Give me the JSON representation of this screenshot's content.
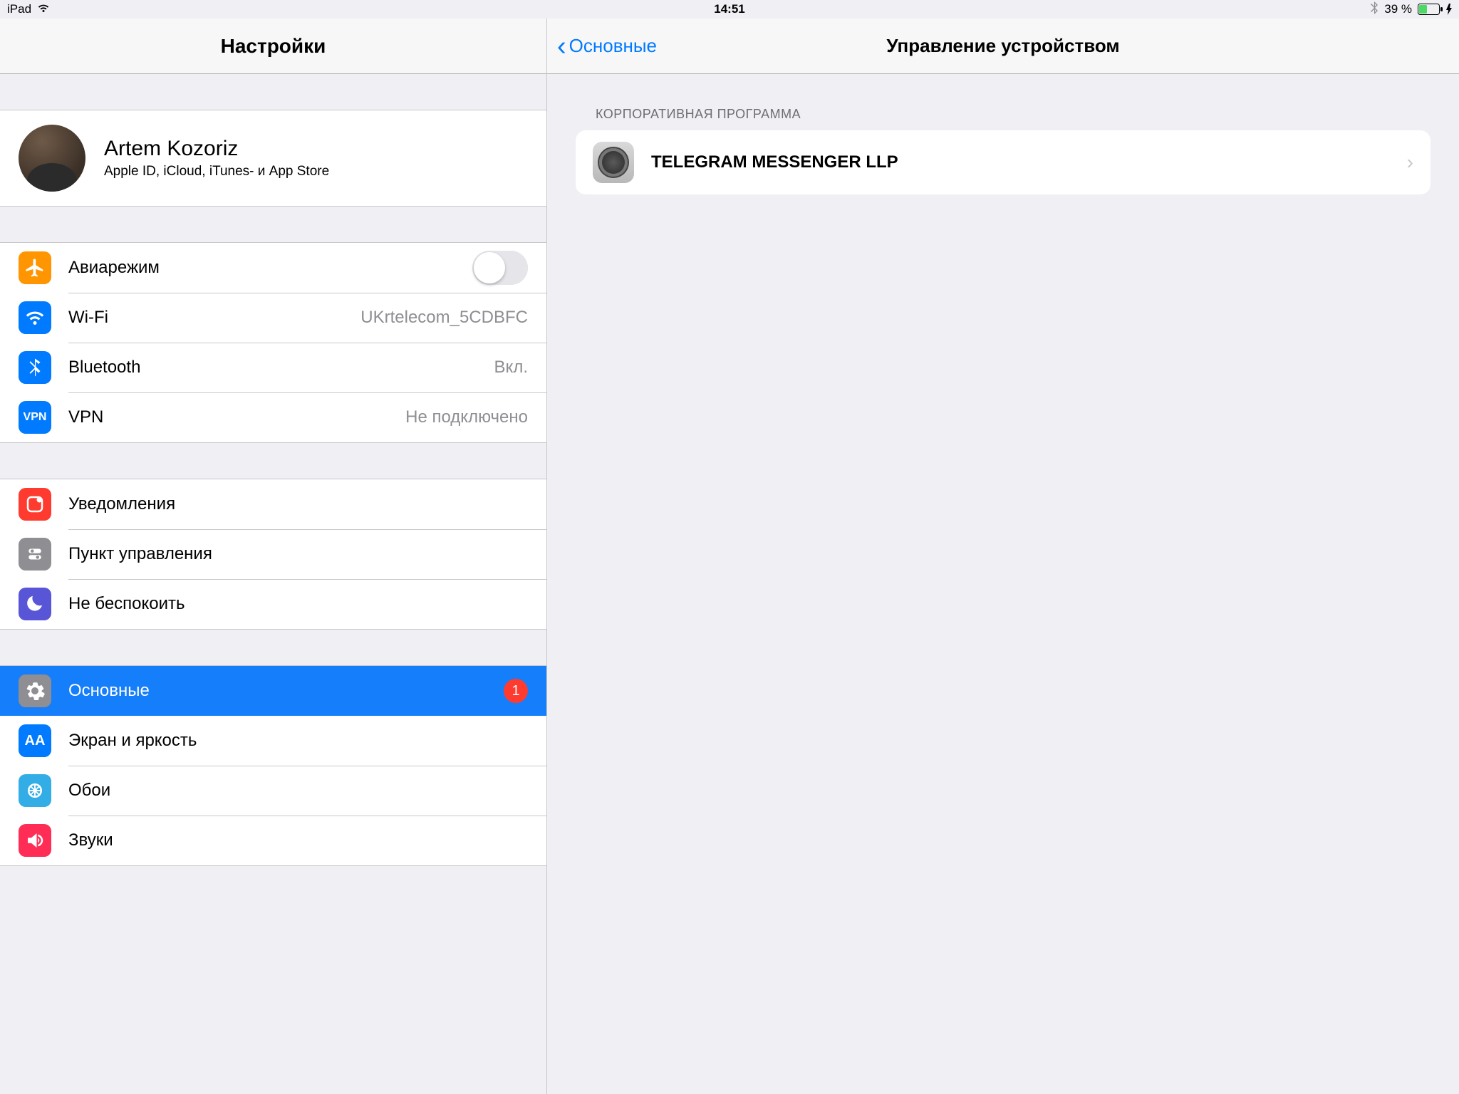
{
  "status": {
    "device": "iPad",
    "time": "14:51",
    "battery_pct": "39 %"
  },
  "left": {
    "title": "Настройки",
    "account": {
      "name": "Artem Kozoriz",
      "subtitle": "Apple ID, iCloud, iTunes- и App Store"
    },
    "connectivity": {
      "airplane": "Авиарежим",
      "wifi": "Wi-Fi",
      "wifi_value": "UKrtelecom_5CDBFC",
      "bluetooth": "Bluetooth",
      "bluetooth_value": "Вкл.",
      "vpn": "VPN",
      "vpn_value": "Не подключено"
    },
    "notifications_group": {
      "notifications": "Уведомления",
      "control_center": "Пункт управления",
      "dnd": "Не беспокоить"
    },
    "general_group": {
      "general": "Основные",
      "general_badge": "1",
      "display": "Экран и яркость",
      "wallpaper": "Обои",
      "sounds": "Звуки"
    }
  },
  "right": {
    "back_label": "Основные",
    "title": "Управление устройством",
    "section_header": "Корпоративная программа",
    "profile_name": "TELEGRAM MESSENGER LLP"
  }
}
